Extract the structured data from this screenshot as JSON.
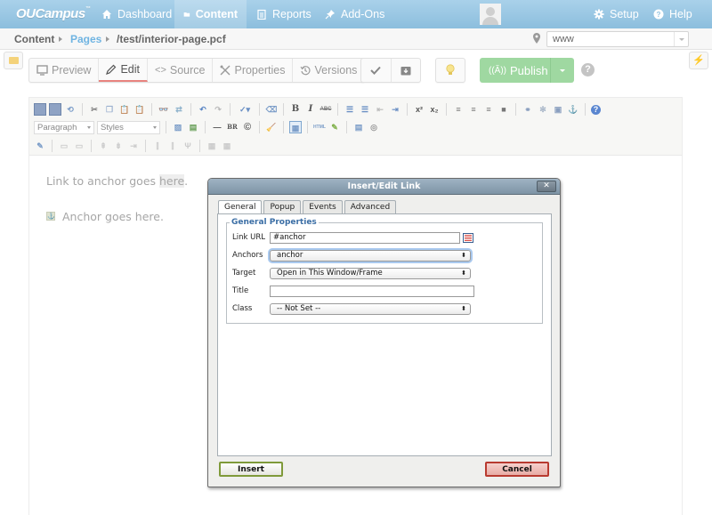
{
  "app": {
    "logo": "OUCampus",
    "nav": [
      {
        "label": "Dashboard",
        "icon": "home-icon"
      },
      {
        "label": "Content",
        "icon": "folder-icon",
        "active": true
      },
      {
        "label": "Reports",
        "icon": "clipboard-icon"
      },
      {
        "label": "Add-Ons",
        "icon": "pin-icon"
      }
    ],
    "setup_label": "Setup",
    "help_label": "Help"
  },
  "breadcrumb": {
    "items": [
      "Content",
      "Pages",
      "/test/interior-page.pcf"
    ],
    "site_select_value": "www"
  },
  "actions": {
    "view_tabs": [
      {
        "label": "Preview",
        "icon": "monitor-icon"
      },
      {
        "label": "Edit",
        "icon": "pencil-icon",
        "active": true
      },
      {
        "label": "Source",
        "icon": "code-icon"
      },
      {
        "label": "Properties",
        "icon": "tools-icon"
      },
      {
        "label": "Versions",
        "icon": "history-icon"
      }
    ],
    "publish_label": "Publish",
    "help_glyph": "?"
  },
  "editor": {
    "format_select": "Paragraph",
    "styles_select": "Styles",
    "toolbar_text_icons": {
      "br": "BR",
      "copyright": "©",
      "html": "HTML",
      "bold": "B",
      "italic": "I",
      "strike": "ABC"
    },
    "content": {
      "link_text_before": "Link to anchor goes ",
      "link_text_highlight": "here",
      "link_text_after": ".",
      "anchor_text": "Anchor goes here."
    }
  },
  "dialog": {
    "title": "Insert/Edit Link",
    "close_glyph": "✕",
    "tabs": [
      "General",
      "Popup",
      "Events",
      "Advanced"
    ],
    "active_tab": "General",
    "legend": "General Properties",
    "fields": {
      "link_url": {
        "label": "Link URL",
        "value": "#anchor"
      },
      "anchors": {
        "label": "Anchors",
        "value": "anchor"
      },
      "target": {
        "label": "Target",
        "value": "Open in This Window/Frame"
      },
      "title": {
        "label": "Title",
        "value": ""
      },
      "class": {
        "label": "Class",
        "value": "-- Not Set --"
      }
    },
    "insert_label": "Insert",
    "cancel_label": "Cancel"
  }
}
